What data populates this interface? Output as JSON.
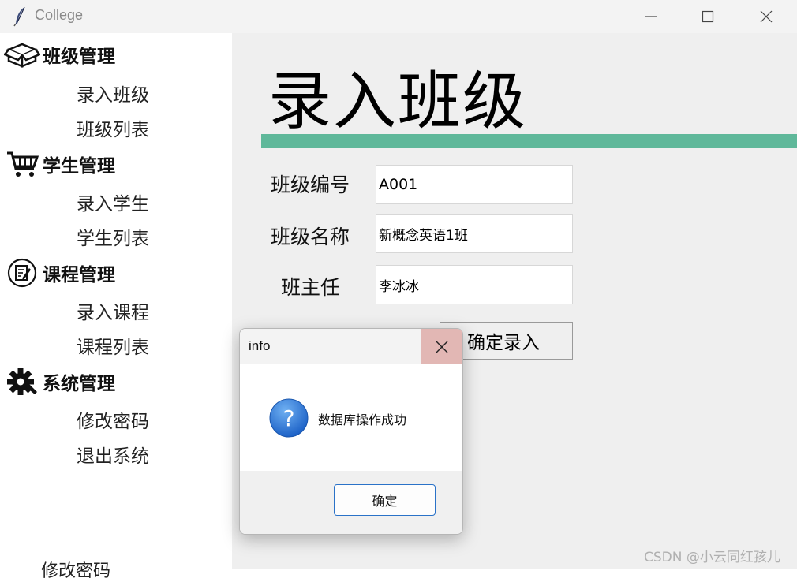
{
  "window": {
    "title": "College"
  },
  "sidebar": {
    "groups": [
      {
        "label": "班级管理",
        "icon": "box-icon",
        "items": [
          "录入班级",
          "班级列表"
        ]
      },
      {
        "label": "学生管理",
        "icon": "cart-icon",
        "items": [
          "录入学生",
          "学生列表"
        ]
      },
      {
        "label": "课程管理",
        "icon": "edit-icon",
        "items": [
          "录入课程",
          "课程列表"
        ]
      },
      {
        "label": "系统管理",
        "icon": "gear-icon",
        "items": [
          "修改密码",
          "退出系统"
        ]
      }
    ],
    "cut_item": "修改密码"
  },
  "main": {
    "title": "录入班级",
    "accent_color": "#5fb89a",
    "form": {
      "class_id_label": "班级编号",
      "class_id_value": "A001",
      "class_name_label": "班级名称",
      "class_name_value": "新概念英语1班",
      "teacher_label": "班主任",
      "teacher_value": "李冰冰",
      "submit_label": "确定录入"
    }
  },
  "dialog": {
    "title": "info",
    "icon": "question-icon",
    "message": "数据库操作成功",
    "ok_label": "确定"
  },
  "watermark": "CSDN @小云同红孩儿"
}
